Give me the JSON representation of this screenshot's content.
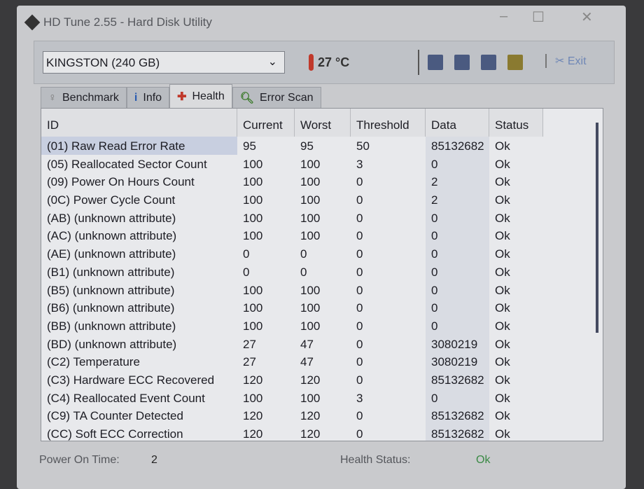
{
  "window": {
    "title": "HD Tune 2.55 - Hard Disk Utility"
  },
  "toolbar": {
    "drive": "KINGSTON (240 GB)",
    "temperature": "27 °C",
    "exit": "Exit"
  },
  "tabs": [
    {
      "label": "Benchmark",
      "icon": "benchmark-icon"
    },
    {
      "label": "Info",
      "icon": "info-icon"
    },
    {
      "label": "Health",
      "icon": "health-cross-icon"
    },
    {
      "label": "Error Scan",
      "icon": "magnifier-icon"
    }
  ],
  "table": {
    "columns": [
      "ID",
      "Current",
      "Worst",
      "Threshold",
      "Data",
      "Status"
    ],
    "rows": [
      [
        "(01) Raw Read Error Rate",
        "95",
        "95",
        "50",
        "85132682",
        "Ok"
      ],
      [
        "(05) Reallocated Sector Count",
        "100",
        "100",
        "3",
        "0",
        "Ok"
      ],
      [
        "(09) Power On Hours Count",
        "100",
        "100",
        "0",
        "2",
        "Ok"
      ],
      [
        "(0C) Power Cycle Count",
        "100",
        "100",
        "0",
        "2",
        "Ok"
      ],
      [
        "(AB) (unknown attribute)",
        "100",
        "100",
        "0",
        "0",
        "Ok"
      ],
      [
        "(AC) (unknown attribute)",
        "100",
        "100",
        "0",
        "0",
        "Ok"
      ],
      [
        "(AE) (unknown attribute)",
        "0",
        "0",
        "0",
        "0",
        "Ok"
      ],
      [
        "(B1) (unknown attribute)",
        "0",
        "0",
        "0",
        "0",
        "Ok"
      ],
      [
        "(B5) (unknown attribute)",
        "100",
        "100",
        "0",
        "0",
        "Ok"
      ],
      [
        "(B6) (unknown attribute)",
        "100",
        "100",
        "0",
        "0",
        "Ok"
      ],
      [
        "(BB) (unknown attribute)",
        "100",
        "100",
        "0",
        "0",
        "Ok"
      ],
      [
        "(BD) (unknown attribute)",
        "27",
        "47",
        "0",
        "3080219",
        "Ok"
      ],
      [
        "(C2) Temperature",
        "27",
        "47",
        "0",
        "3080219",
        "Ok"
      ],
      [
        "(C3) Hardware ECC Recovered",
        "120",
        "120",
        "0",
        "85132682",
        "Ok"
      ],
      [
        "(C4) Reallocated Event Count",
        "100",
        "100",
        "3",
        "0",
        "Ok"
      ],
      [
        "(C9) TA Counter Detected",
        "120",
        "120",
        "0",
        "85132682",
        "Ok"
      ],
      [
        "(CC) Soft ECC Correction",
        "120",
        "120",
        "0",
        "85132682",
        "Ok"
      ]
    ]
  },
  "footer": {
    "power_on_label": "Power On Time:",
    "power_on_value": "2",
    "health_label": "Health Status:",
    "health_value": "Ok",
    "health_color": "#3a8a45"
  }
}
